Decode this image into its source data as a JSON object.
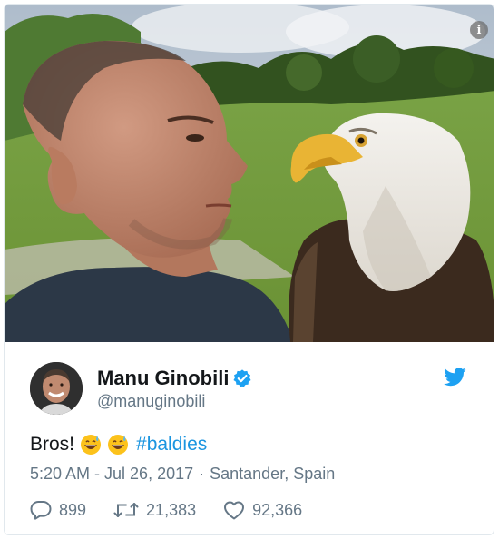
{
  "photo": {
    "description_icon": "info-icon",
    "info_label": "i"
  },
  "tweet": {
    "author": {
      "display_name": "Manu Ginobili",
      "handle": "@manuginobili",
      "verified": true
    },
    "text_word": "Bros!",
    "emojis": [
      "grinning-face-with-sweat-emoji",
      "grinning-face-with-sweat-emoji"
    ],
    "hashtag": "#baldies",
    "time": "5:20 AM - Jul 26, 2017",
    "separator": "·",
    "location": "Santander, Spain",
    "counts": {
      "replies": "899",
      "retweets": "21,383",
      "likes": "92,366"
    }
  },
  "colors": {
    "name": "#14171a",
    "secondary": "#657786",
    "link": "#1b95e0",
    "twitter_blue": "#1da1f2"
  }
}
